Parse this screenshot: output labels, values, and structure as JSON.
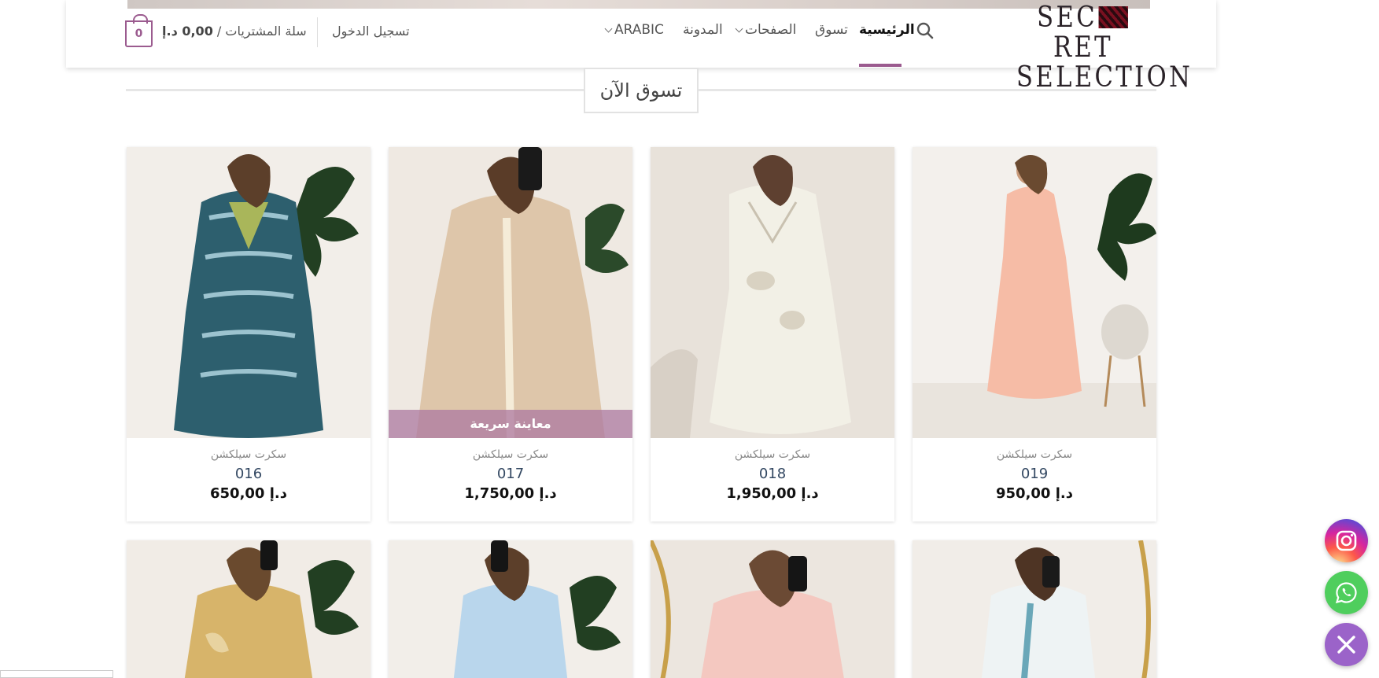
{
  "header": {
    "logo_line1_left": "SEC",
    "logo_line1_right": "RET",
    "logo_line2": "SELECTION",
    "nav": {
      "home": "الرئيسية",
      "shop": "تسوق",
      "pages": "الصفحات",
      "blog": "المدونة",
      "language": "ARABIC"
    },
    "login": "تسجيل الدخول",
    "cart_label": "سلة المشتريات /",
    "cart_total": "0,00 د.إ",
    "cart_count": "0"
  },
  "section": {
    "title": "تسوق الآن"
  },
  "products": [
    {
      "category": "سكرت سيلكشن",
      "title": "019",
      "price": "950,00 د.إ"
    },
    {
      "category": "سكرت سيلكشن",
      "title": "018",
      "price": "1,950,00 د.إ"
    },
    {
      "category": "سكرت سيلكشن",
      "title": "017",
      "price": "1,750,00 د.إ",
      "quick_view": "معاينة سريعة"
    },
    {
      "category": "سكرت سيلكشن",
      "title": "016",
      "price": "650,00 د.إ"
    }
  ],
  "icons": {
    "search": "search-icon",
    "instagram": "instagram-icon",
    "whatsapp": "whatsapp-icon",
    "close": "close-icon"
  },
  "colors": {
    "accent": "#9b5b8f",
    "link": "#334862",
    "instagram": "#d6249f",
    "whatsapp": "#4fce5d",
    "close": "#9b63c9"
  }
}
